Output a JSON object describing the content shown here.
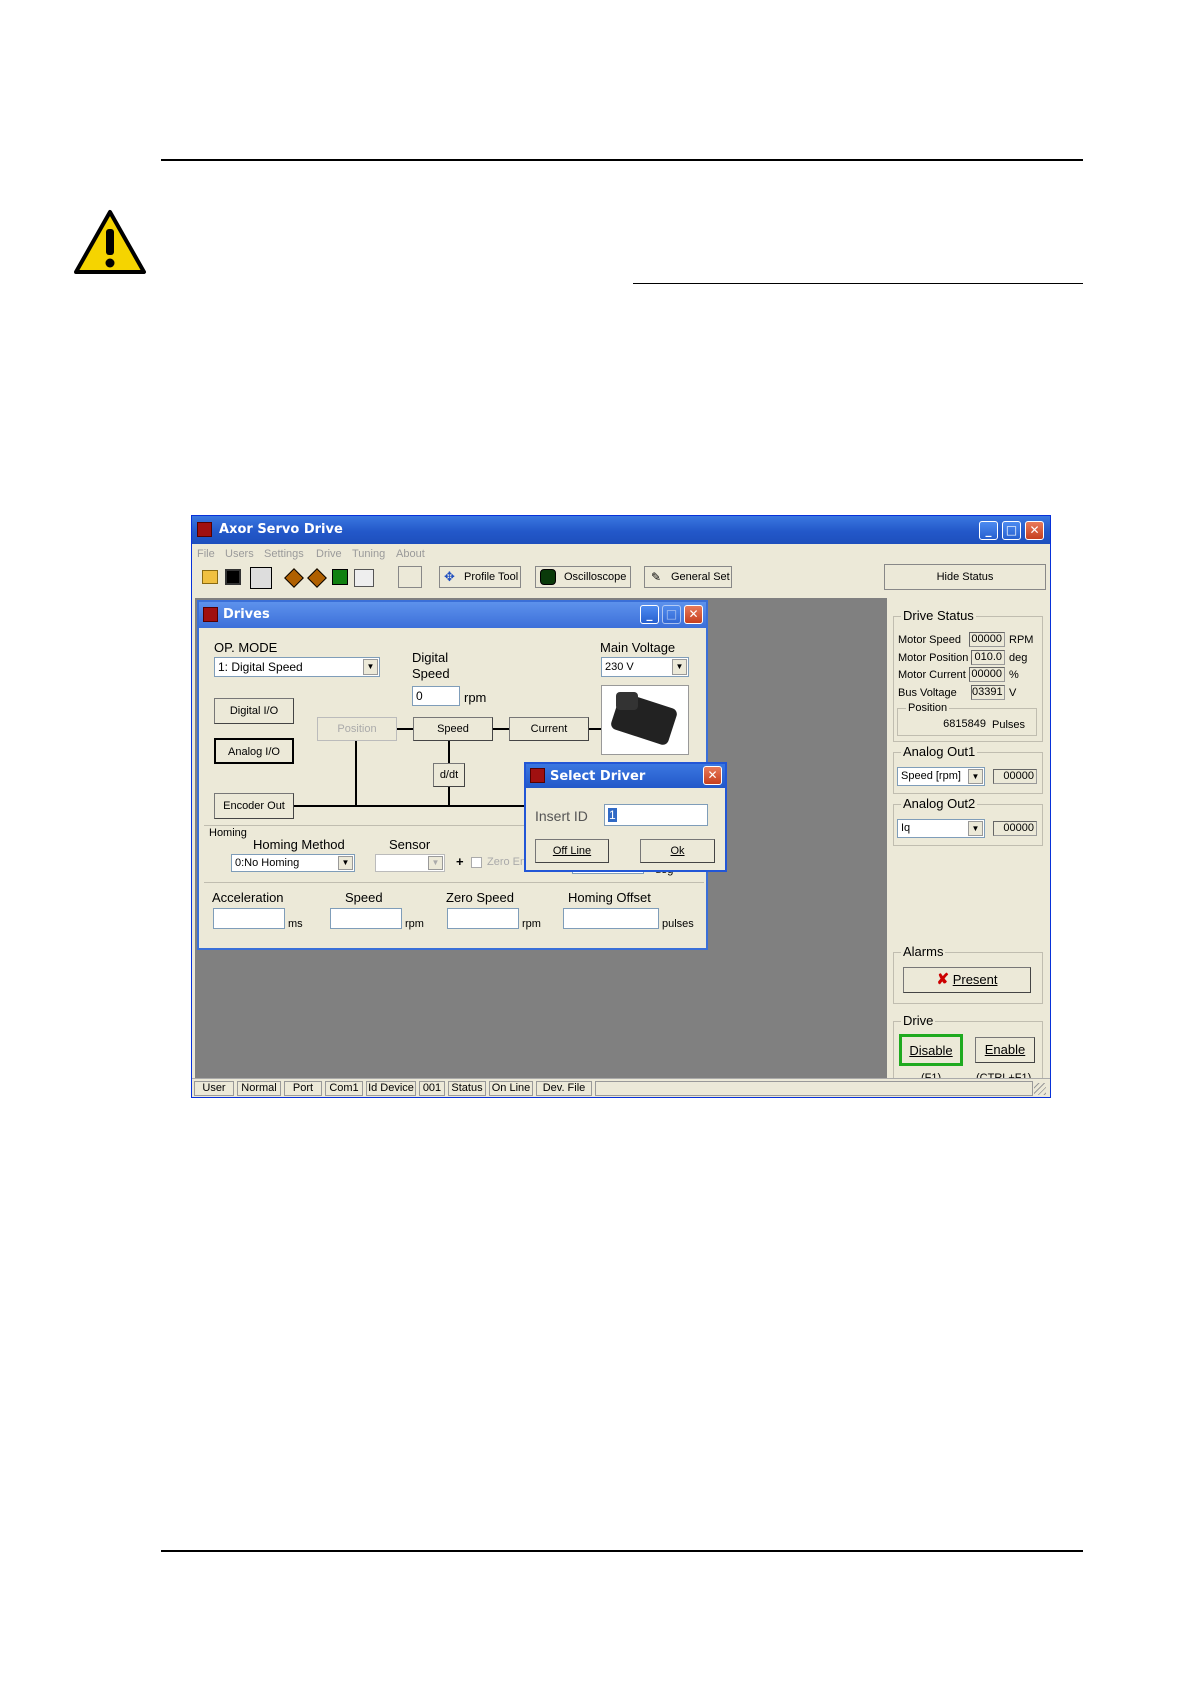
{
  "app": {
    "title": "Axor Servo Drive",
    "menu": [
      "File",
      "Users",
      "Settings",
      "Drive",
      "Tuning",
      "About"
    ],
    "toolbar": {
      "profile_tool": "Profile Tool",
      "oscilloscope": "Oscilloscope",
      "general_set": "General Set",
      "hide_status": "Hide Status"
    }
  },
  "drives": {
    "title": "Drives",
    "op_mode_label": "OP. MODE",
    "op_mode_value": "1: Digital Speed",
    "digital_speed_label_1": "Digital",
    "digital_speed_label_2": "Speed",
    "digital_speed_value": "0",
    "digital_speed_unit": "rpm",
    "main_voltage_label": "Main Voltage",
    "main_voltage_value": "230 V",
    "digital_io": "Digital I/O",
    "analog_io": "Analog I/O",
    "encoder_out": "Encoder Out",
    "position": "Position",
    "speed": "Speed",
    "current": "Current",
    "ddt": "d/dt",
    "homing": {
      "legend": "Homing",
      "method_label": "Homing Method",
      "method_value": "0:No Homing",
      "sensor_label": "Sensor",
      "plus": "+",
      "zero_encoder": "Zero Encoder",
      "deg": "deg"
    },
    "acceleration_label": "Acceleration",
    "acceleration_unit": "ms",
    "speed_label": "Speed",
    "speed_unit": "rpm",
    "zero_speed_label": "Zero Speed",
    "zero_speed_unit": "rpm",
    "homing_offset_label": "Homing Offset",
    "homing_offset_unit": "pulses"
  },
  "dialog": {
    "title": "Select Driver",
    "insert_id_label": "Insert ID",
    "insert_id_value": "1",
    "off_line": "Off Line",
    "ok": "Ok"
  },
  "status": {
    "drive_status_legend": "Drive Status",
    "motor_speed_label": "Motor Speed",
    "motor_speed_value": "00000",
    "motor_speed_unit": "RPM",
    "motor_position_label": "Motor Position",
    "motor_position_value": "010.0",
    "motor_position_unit": "deg",
    "motor_current_label": "Motor Current",
    "motor_current_value": "00000",
    "motor_current_unit": "%",
    "bus_voltage_label": "Bus Voltage",
    "bus_voltage_value": "03391",
    "bus_voltage_unit": "V",
    "position_legend": "Position",
    "position_value": "6815849",
    "position_unit": "Pulses",
    "analog_out1_legend": "Analog Out1",
    "analog_out1_select": "Speed [rpm]",
    "analog_out1_value": "00000",
    "analog_out2_legend": "Analog Out2",
    "analog_out2_select": "Iq",
    "analog_out2_value": "00000",
    "alarms_legend": "Alarms",
    "alarms_button": "Present",
    "drive_legend": "Drive",
    "disable": "Disable",
    "enable": "Enable",
    "disable_key": "(F1)",
    "enable_key": "(CTRL+F1)"
  },
  "statusbar": [
    "User",
    "Normal",
    "Port",
    "Com1",
    "Id Device",
    "001",
    "Status",
    "On Line",
    "Dev. File"
  ],
  "colors": {
    "warning_yellow": "#f5d400",
    "titlebar_blue": "#2358c9",
    "alarm_red": "#cc0000",
    "disable_highlight": "#1faa1f"
  }
}
